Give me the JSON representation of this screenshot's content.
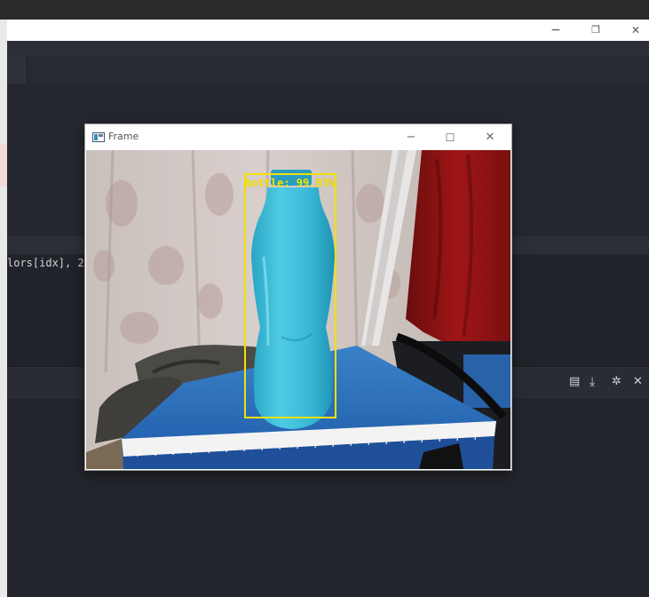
{
  "ide": {
    "code_line": "lors[idx], 2"
  },
  "bg_window": {
    "minimize": "−",
    "restore": "❐",
    "close": "✕"
  },
  "frame_window": {
    "title": "Frame",
    "controls": {
      "minimize": "−",
      "maximize": "☐",
      "close": "✕"
    },
    "detection": {
      "label": "bottle: 99.93%",
      "box_color": "#f2e000"
    }
  },
  "panel_toolbar": {
    "icons": [
      "document-icon",
      "download-icon",
      "settings-icon",
      "close-icon"
    ],
    "glyphs": {
      "document": "▤",
      "download": "⤓",
      "settings": "✲",
      "close": "✕"
    }
  },
  "colors": {
    "ide_background": "#23252c",
    "bottle": "#35b9d6",
    "notebook": "#2d6db8"
  }
}
